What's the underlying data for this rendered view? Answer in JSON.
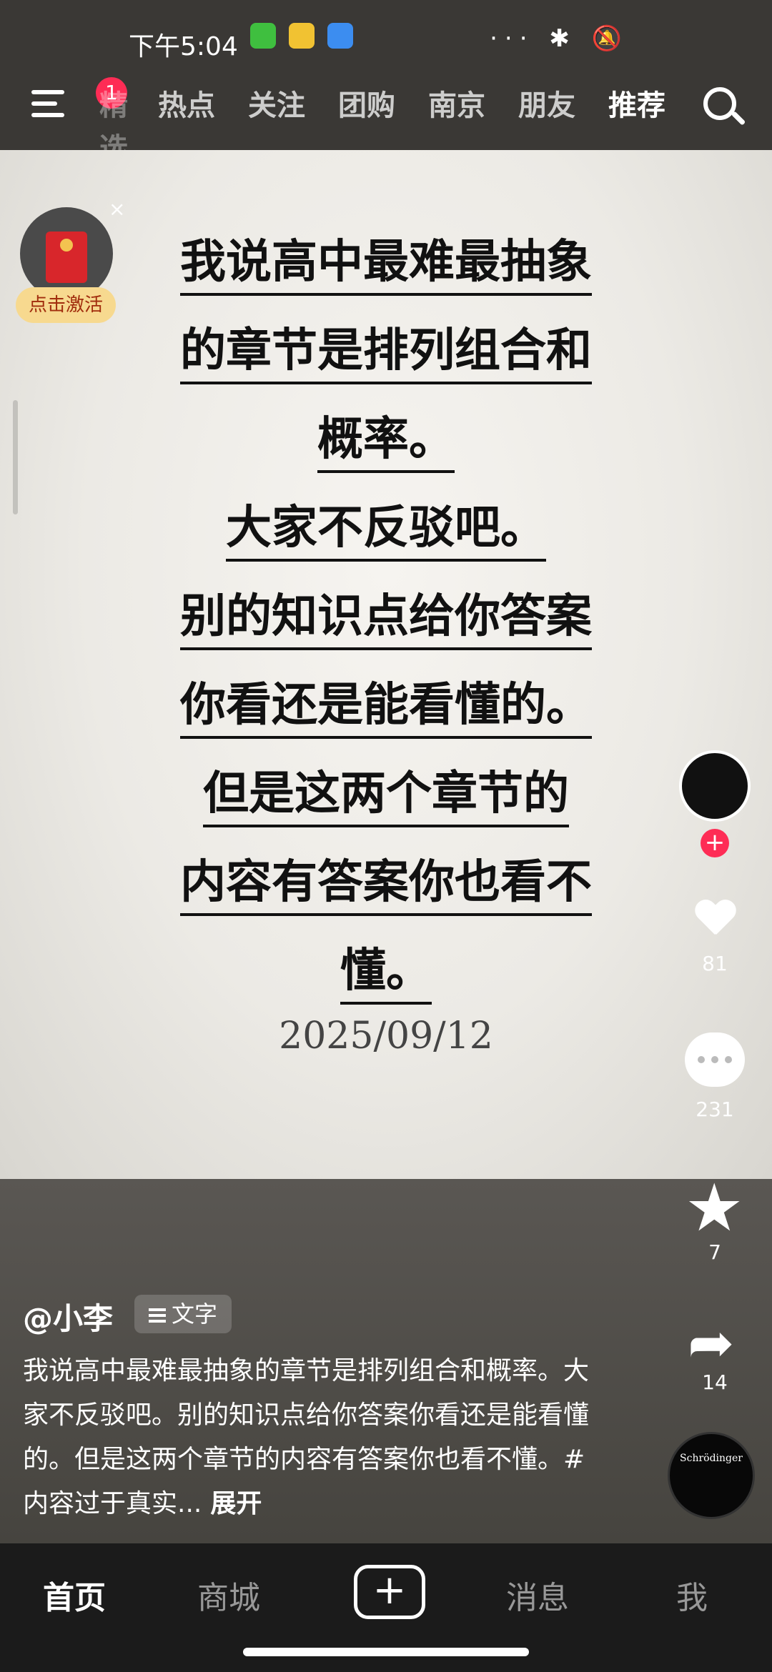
{
  "status_bar": {
    "time": "下午5:04",
    "right": "··· ✱ 🔕"
  },
  "top_nav": {
    "badge_count": "1",
    "tabs": [
      {
        "label": "精选",
        "state": "faded"
      },
      {
        "label": "热点"
      },
      {
        "label": "关注"
      },
      {
        "label": "团购"
      },
      {
        "label": "南京"
      },
      {
        "label": "朋友"
      },
      {
        "label": "推荐",
        "state": "active"
      }
    ],
    "search_icon": "search-icon"
  },
  "post": {
    "quote_lines": [
      "我说高中最难最抽象",
      "的章节是排列组合和",
      "概率。",
      "大家不反驳吧。",
      "别的知识点给你答案",
      "你看还是能看懂的。",
      "但是这两个章节的",
      "内容有答案你也看不",
      "懂。"
    ],
    "date": "2025/09/12"
  },
  "red_packet": {
    "label": "点击激活",
    "close": "×"
  },
  "author": {
    "username": "@小李",
    "tag": "文字"
  },
  "description": {
    "text": "我说高中最难最抽象的章节是排列组合和概率。大家不反驳吧。别的知识点给你答案你看还是能看懂的。但是这两个章节的内容有答案你也看不懂。#内容过于真实...",
    "more": "展开"
  },
  "actions": {
    "follow_plus": "+",
    "likes": "81",
    "comments": "231",
    "favorites": "7",
    "shares": "14",
    "music_text": "Schrödinger"
  },
  "bottom_nav": {
    "home": "首页",
    "mall": "商城",
    "create": "+",
    "messages": "消息",
    "me": "我"
  }
}
